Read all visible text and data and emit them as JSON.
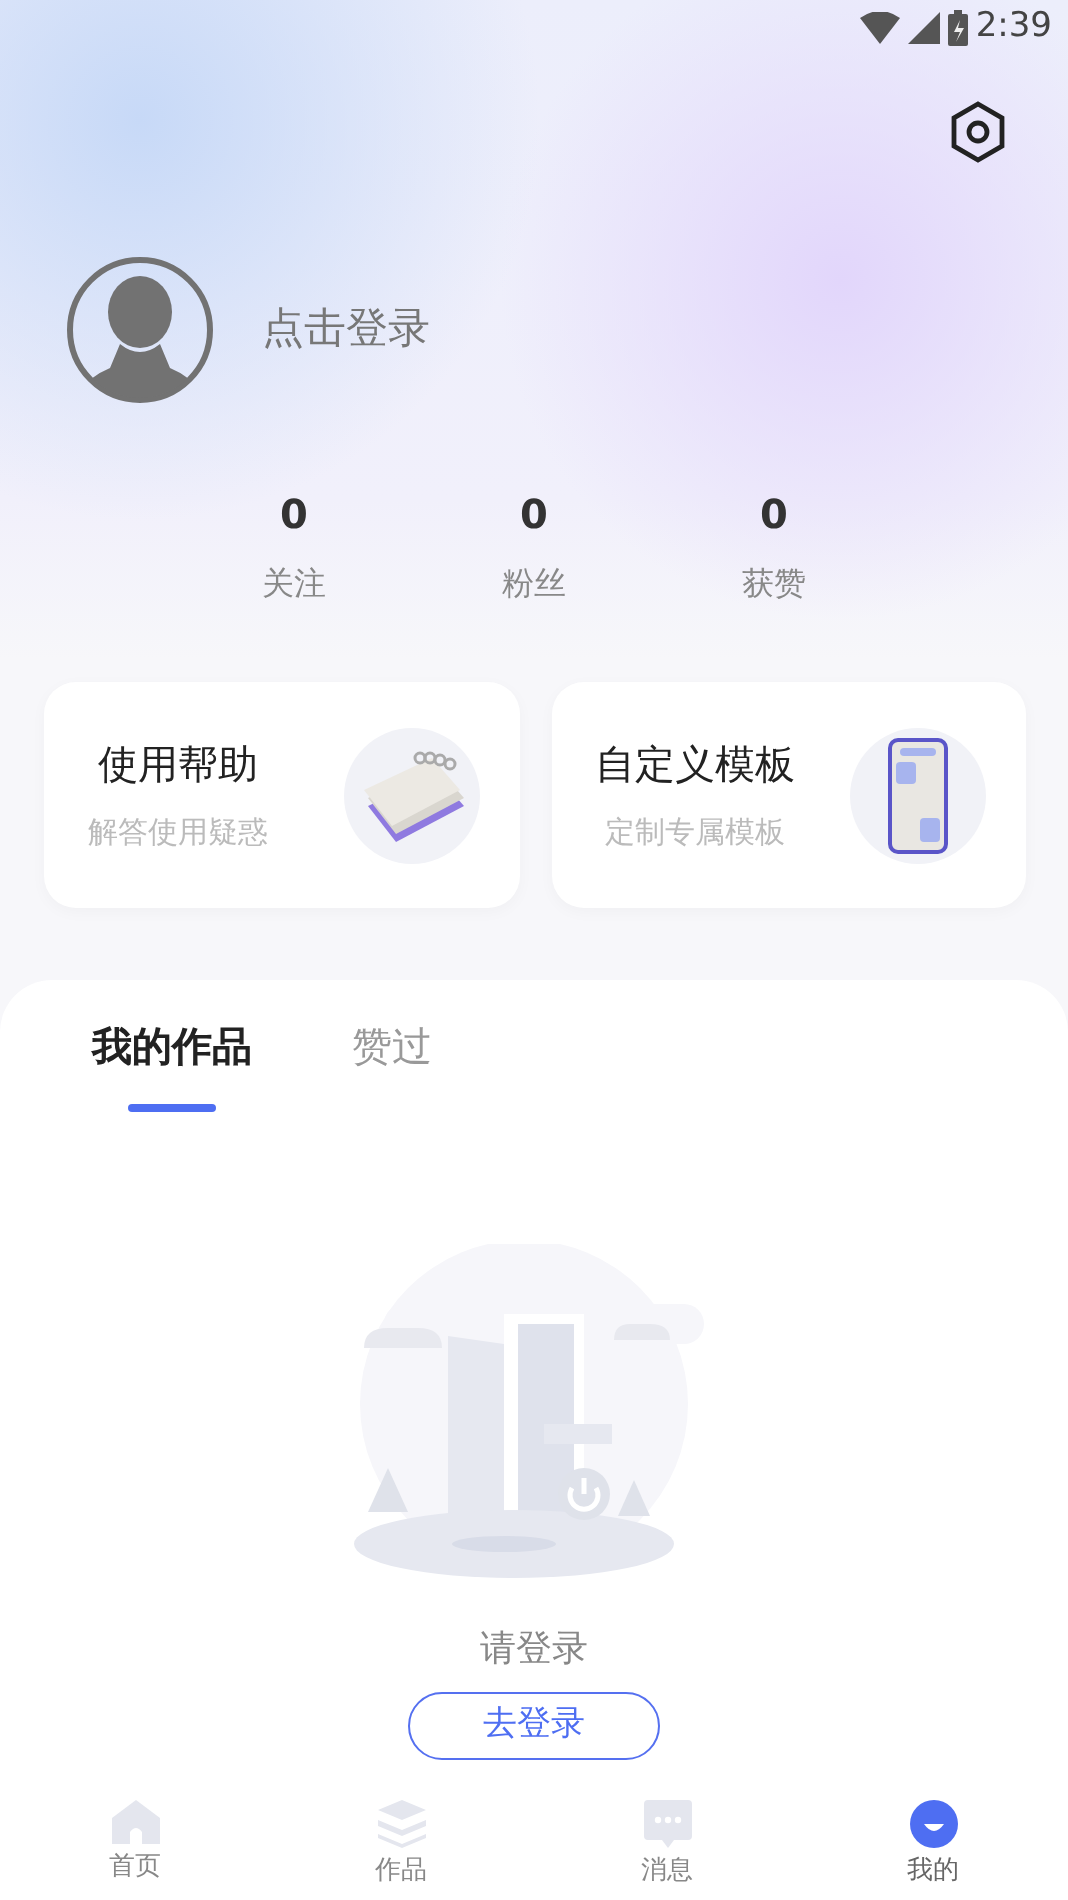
{
  "status_bar": {
    "time": "2:39"
  },
  "profile": {
    "login_prompt": "点击登录"
  },
  "stats": [
    {
      "value": "0",
      "label": "关注"
    },
    {
      "value": "0",
      "label": "粉丝"
    },
    {
      "value": "0",
      "label": "获赞"
    }
  ],
  "cards": [
    {
      "kind": "notebook",
      "title": "使用帮助",
      "subtitle": "解答使用疑惑"
    },
    {
      "kind": "phone",
      "title": "自定义模板",
      "subtitle": "定制专属模板"
    }
  ],
  "tabs": [
    {
      "label": "我的作品",
      "selected": true
    },
    {
      "label": "赞过",
      "selected": false
    }
  ],
  "empty_state": {
    "message": "请登录",
    "button": "去登录"
  },
  "bottom_nav": [
    {
      "kind": "home",
      "label": "首页",
      "selected": false
    },
    {
      "kind": "works",
      "label": "作品",
      "selected": false
    },
    {
      "kind": "messages",
      "label": "消息",
      "selected": false
    },
    {
      "kind": "mine",
      "label": "我的",
      "selected": true
    }
  ]
}
